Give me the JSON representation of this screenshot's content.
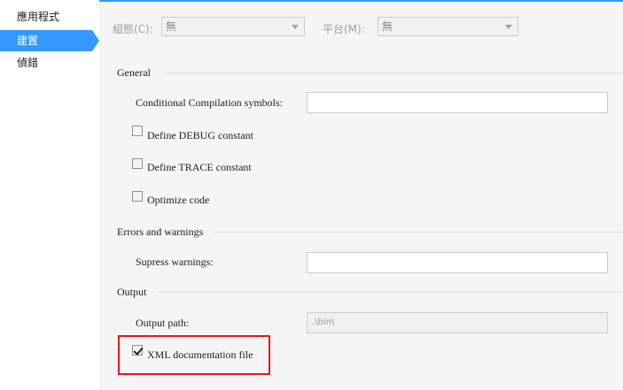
{
  "sidebar": {
    "items": [
      {
        "label": "應用程式"
      },
      {
        "label": "建置",
        "selected": true
      },
      {
        "label": "偵錯"
      }
    ]
  },
  "toolbar": {
    "configuration_label": "組態(C):",
    "configuration_value": "無",
    "platform_label": "平台(M):",
    "platform_value": "無"
  },
  "general": {
    "heading": "General",
    "conditional_symbols_label": "Conditional Compilation symbols:",
    "conditional_symbols_value": "",
    "define_debug_label": "Define DEBUG constant",
    "define_debug_checked": false,
    "define_trace_label": "Define TRACE constant",
    "define_trace_checked": false,
    "optimize_label": "Optimize code",
    "optimize_checked": false
  },
  "errors": {
    "heading": "Errors and warnings",
    "suppress_label": "Supress warnings:",
    "suppress_value": ""
  },
  "output": {
    "heading": "Output",
    "path_label": "Output path:",
    "path_value": ".\\bin\\",
    "xml_doc_label": "XML documentation file",
    "xml_doc_checked": true
  },
  "colors": {
    "accent": "#3399ff",
    "highlight": "#e8161a"
  }
}
